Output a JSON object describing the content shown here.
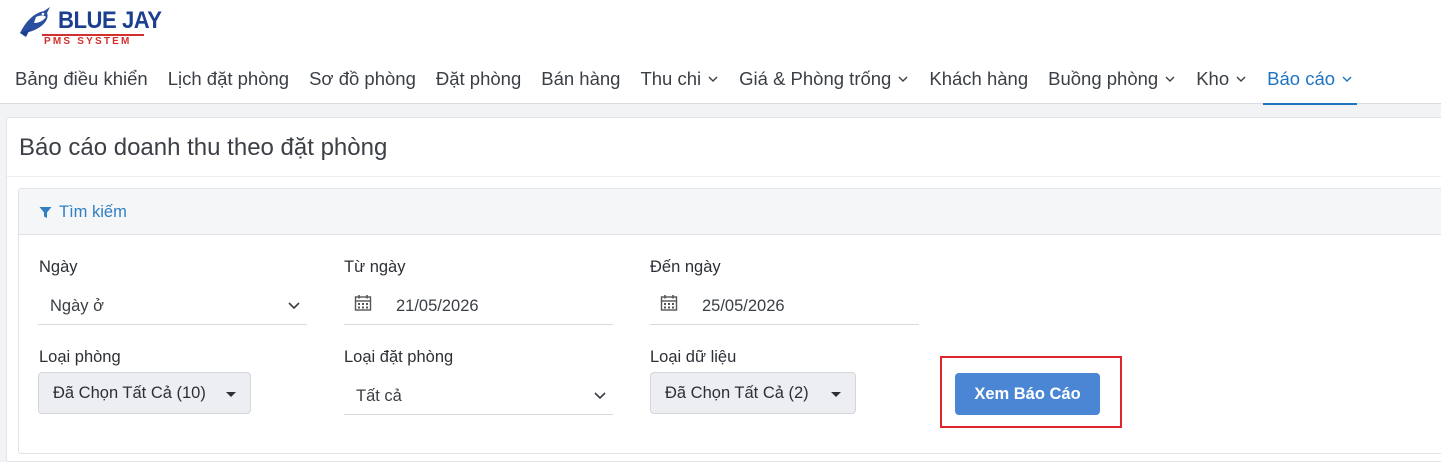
{
  "logo": {
    "brand": "BLUE JAY",
    "subtitle": "PMS SYSTEM"
  },
  "nav": {
    "items": [
      {
        "label": "Bảng điều khiển",
        "dropdown": false,
        "active": false
      },
      {
        "label": "Lịch đặt phòng",
        "dropdown": false,
        "active": false
      },
      {
        "label": "Sơ đồ phòng",
        "dropdown": false,
        "active": false
      },
      {
        "label": "Đặt phòng",
        "dropdown": false,
        "active": false
      },
      {
        "label": "Bán hàng",
        "dropdown": false,
        "active": false
      },
      {
        "label": "Thu chi",
        "dropdown": true,
        "active": false
      },
      {
        "label": "Giá & Phòng trống",
        "dropdown": true,
        "active": false
      },
      {
        "label": "Khách hàng",
        "dropdown": false,
        "active": false
      },
      {
        "label": "Buồng phòng",
        "dropdown": true,
        "active": false
      },
      {
        "label": "Kho",
        "dropdown": true,
        "active": false
      },
      {
        "label": "Báo cáo",
        "dropdown": true,
        "active": true
      }
    ]
  },
  "page": {
    "title": "Báo cáo doanh thu theo đặt phòng"
  },
  "search": {
    "header": "Tìm kiếm",
    "ngay": {
      "label": "Ngày",
      "value": "Ngày ở"
    },
    "tu_ngay": {
      "label": "Từ ngày",
      "value": "21/05/2026"
    },
    "den_ngay": {
      "label": "Đến ngày",
      "value": "25/05/2026"
    },
    "loai_phong": {
      "label": "Loại phòng",
      "value": "Đã Chọn Tất Cả (10)"
    },
    "loai_dat_phong": {
      "label": "Loại đặt phòng",
      "value": "Tất cả"
    },
    "loai_du_lieu": {
      "label": "Loại dữ liệu",
      "value": "Đã Chọn Tất Cả (2)"
    },
    "submit_label": "Xem Báo Cáo"
  },
  "colors": {
    "accent": "#1f74c2",
    "primary_button": "#4a86d4",
    "highlight": "#e0262b"
  }
}
